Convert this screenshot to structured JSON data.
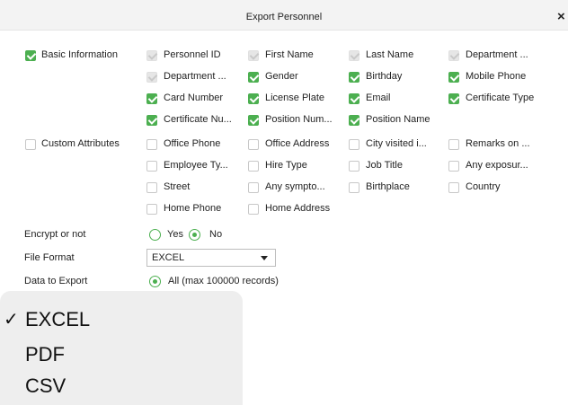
{
  "dialog": {
    "title": "Export Personnel",
    "close_symbol": "×"
  },
  "sections": {
    "basic": {
      "label": "Basic Information",
      "items": [
        {
          "label": "Personnel ID",
          "state": "disabled"
        },
        {
          "label": "First Name",
          "state": "disabled"
        },
        {
          "label": "Last Name",
          "state": "disabled"
        },
        {
          "label": "Department ...",
          "state": "disabled"
        },
        {
          "label": "Department ...",
          "state": "disabled"
        },
        {
          "label": "Gender",
          "state": "checked"
        },
        {
          "label": "Birthday",
          "state": "checked"
        },
        {
          "label": "Mobile Phone",
          "state": "checked"
        },
        {
          "label": "Card Number",
          "state": "checked"
        },
        {
          "label": "License Plate",
          "state": "checked"
        },
        {
          "label": "Email",
          "state": "checked"
        },
        {
          "label": "Certificate Type",
          "state": "checked"
        },
        {
          "label": "Certificate Nu...",
          "state": "checked"
        },
        {
          "label": "Position Num...",
          "state": "checked"
        },
        {
          "label": "Position Name",
          "state": "checked"
        }
      ]
    },
    "custom": {
      "label": "Custom Attributes",
      "items": [
        {
          "label": "Office Phone",
          "state": "unchecked"
        },
        {
          "label": "Office Address",
          "state": "unchecked"
        },
        {
          "label": "City visited i...",
          "state": "unchecked"
        },
        {
          "label": "Remarks on ...",
          "state": "unchecked"
        },
        {
          "label": "Employee Ty...",
          "state": "unchecked"
        },
        {
          "label": "Hire Type",
          "state": "unchecked"
        },
        {
          "label": "Job Title",
          "state": "unchecked"
        },
        {
          "label": "Any exposur...",
          "state": "unchecked"
        },
        {
          "label": "Street",
          "state": "unchecked"
        },
        {
          "label": "Any sympto...",
          "state": "unchecked"
        },
        {
          "label": "Birthplace",
          "state": "unchecked"
        },
        {
          "label": "Country",
          "state": "unchecked"
        },
        {
          "label": "Home Phone",
          "state": "unchecked"
        },
        {
          "label": "Home Address",
          "state": "unchecked"
        }
      ]
    }
  },
  "encrypt": {
    "label": "Encrypt or not",
    "yes": "Yes",
    "no": "No",
    "selected": "No"
  },
  "file_format": {
    "label": "File Format",
    "value": "EXCEL"
  },
  "data_to_export": {
    "label": "Data to Export",
    "option": "All (max 100000 records)"
  },
  "dropdown": {
    "check_symbol": "✓",
    "options": [
      "EXCEL",
      "PDF",
      "CSV"
    ],
    "selected": "EXCEL"
  },
  "colors": {
    "accent": "#4caf50",
    "titlebar": "#f3f3f3",
    "dropdown_bg": "#eeeeee"
  }
}
